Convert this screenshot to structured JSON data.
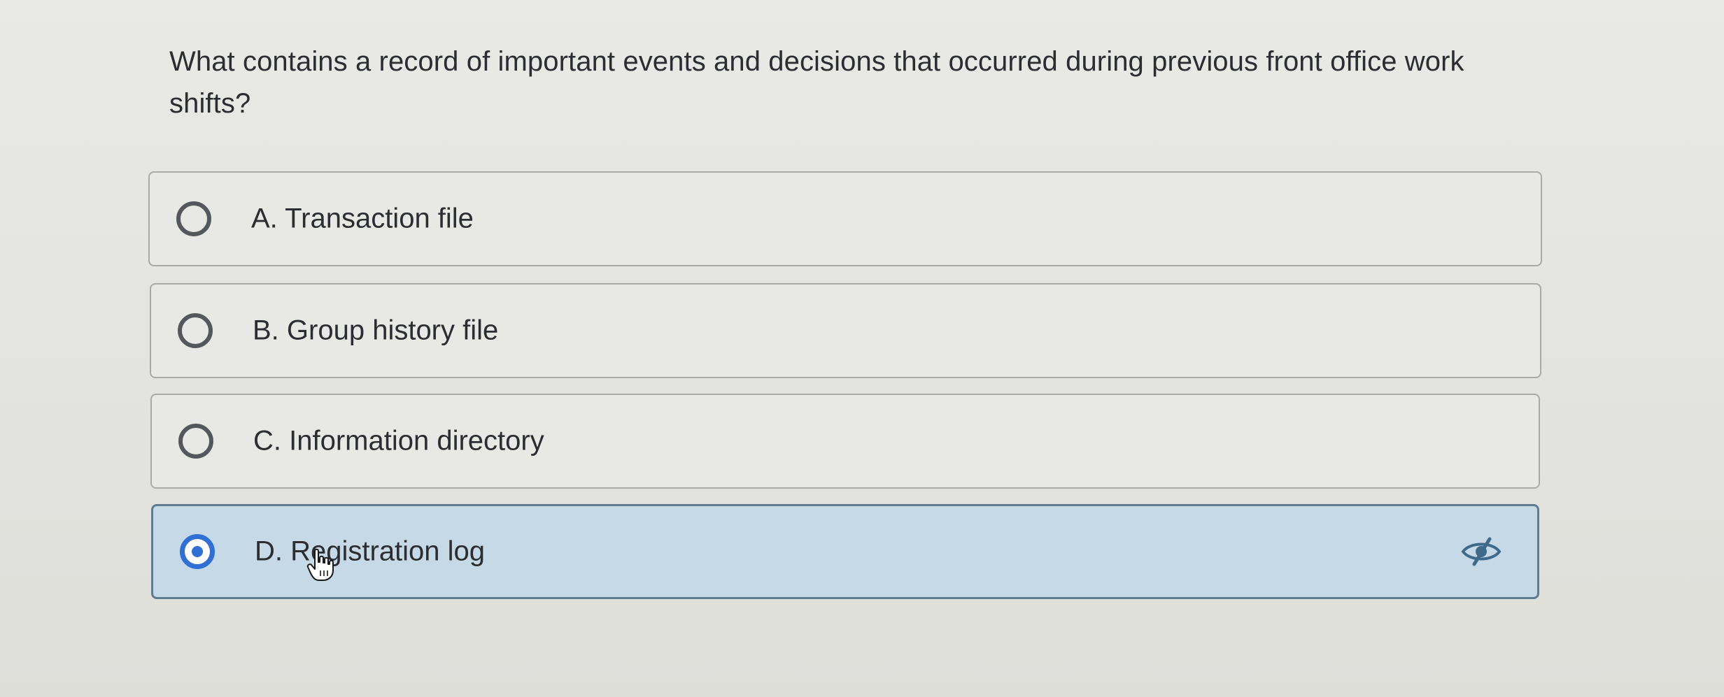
{
  "question": {
    "text": "What contains a record of important events and decisions that occurred during previous front office work shifts?"
  },
  "options": [
    {
      "label": "A. Transaction file",
      "selected": false
    },
    {
      "label": "B. Group history file",
      "selected": false
    },
    {
      "label": "C. Information directory",
      "selected": false
    },
    {
      "label": "D. Registration log",
      "selected": true
    }
  ],
  "icons": {
    "hide_answer": "eye-slash-icon",
    "cursor": "hand-pointer-icon"
  },
  "colors": {
    "selected_background": "#c5d9e6",
    "radio_selected": "#2f6fd6",
    "selected_border": "#5f7c92"
  }
}
